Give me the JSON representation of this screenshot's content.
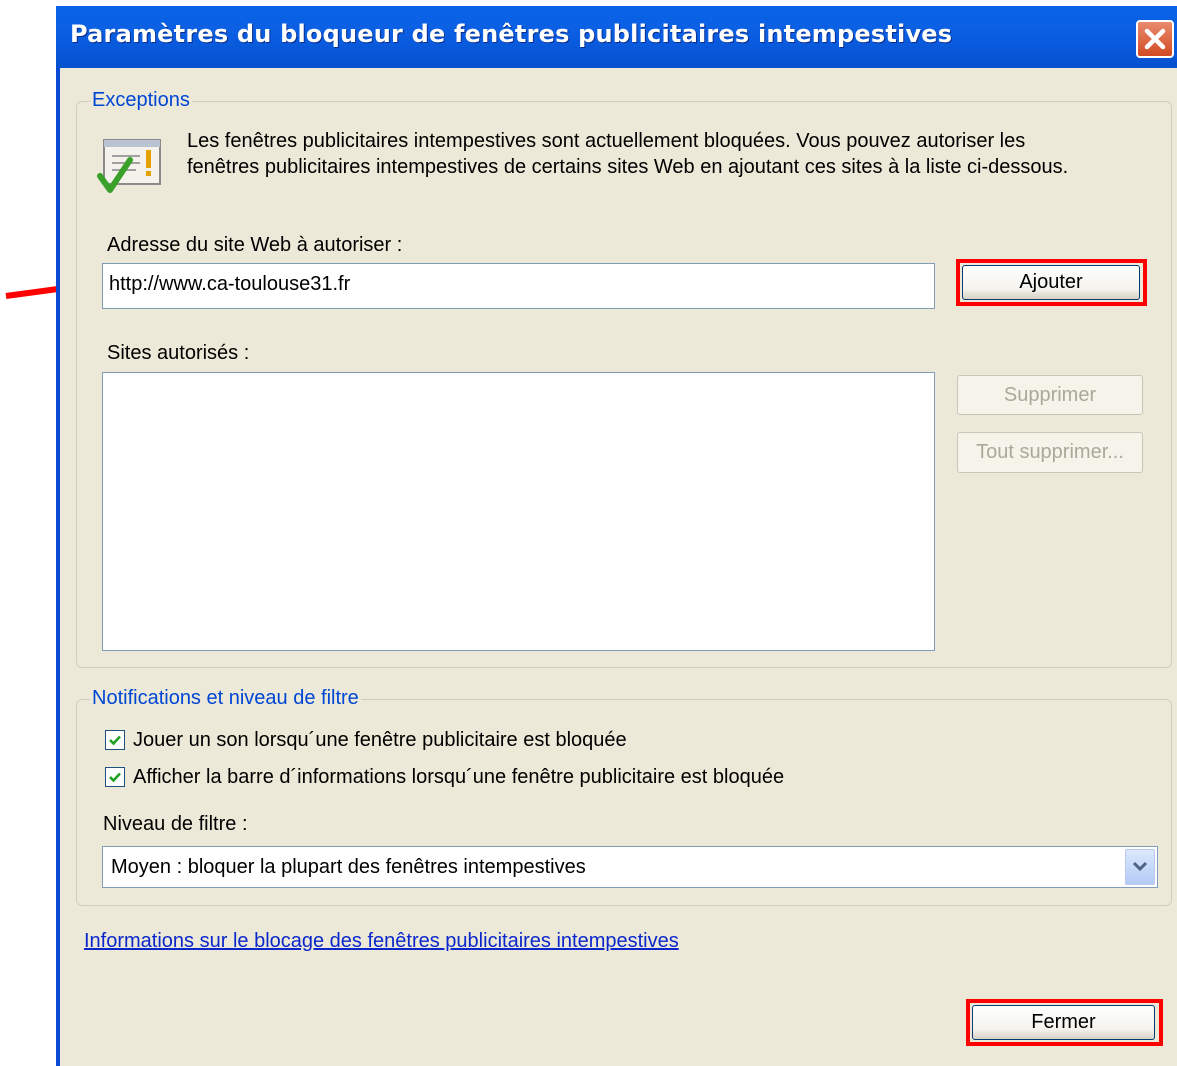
{
  "dialog": {
    "title": "Paramètres du bloqueur de fenêtres publicitaires intempestives"
  },
  "exceptions": {
    "legend": "Exceptions",
    "info_line1": "Les fenêtres publicitaires intempestives sont actuellement bloquées.  Vous pouvez autoriser les",
    "info_line2": "fenêtres publicitaires intempestives de certains sites Web en ajoutant ces sites à la liste ci-dessous.",
    "address_label": "Adresse du site Web à autoriser :",
    "address_value": "http://www.ca-toulouse31.fr",
    "add_button": "Ajouter",
    "allowed_label": "Sites autorisés :",
    "allowed_sites": [],
    "remove_button": "Supprimer",
    "remove_all_button": "Tout supprimer..."
  },
  "notifications": {
    "legend": "Notifications et niveau de filtre",
    "play_sound_label": "Jouer un son lorsqu´une fenêtre publicitaire est bloquée",
    "play_sound_checked": true,
    "show_infobar_label": "Afficher la barre d´informations lorsqu´une fenêtre publicitaire est bloquée",
    "show_infobar_checked": true,
    "filter_label": "Niveau de filtre :",
    "filter_value": "Moyen : bloquer la plupart des fenêtres intempestives"
  },
  "link_text": "Informations sur le blocage des fenêtres publicitaires intempestives",
  "close_button": "Fermer",
  "colors": {
    "title_bar": "#0A63E8",
    "highlight": "#FF0000",
    "legend": "#0046D5",
    "dialog_bg": "#ECE9D8"
  }
}
